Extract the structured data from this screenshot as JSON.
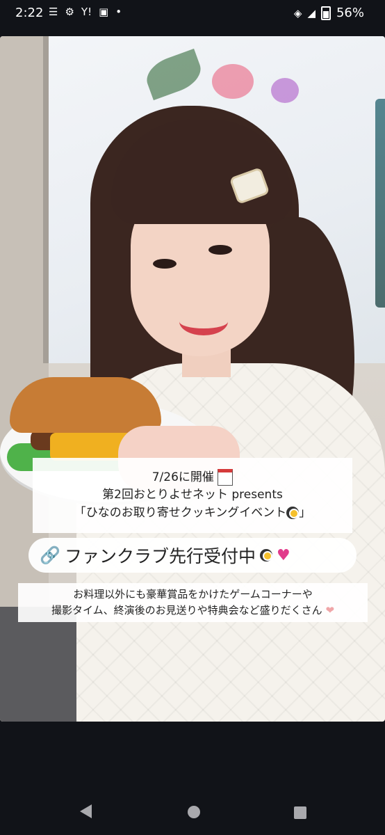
{
  "status_bar": {
    "time": "2:22",
    "notification_icons": [
      "chat-icon",
      "gear-icon",
      "yahoo-icon",
      "image-icon",
      "dot-icon"
    ],
    "yahoo_text": "Y!",
    "battery_text": "56%"
  },
  "overlay": {
    "line1": "7/26に開催",
    "line2": "第2回おとりよせネット presents",
    "line3": "「ひなのお取り寄せクッキングイベント",
    "line3_end": "」",
    "fanclub_text": "ファンクラブ先行受付中",
    "desc_line1": "お料理以外にも豪華賞品をかけたゲームコーナーや",
    "desc_line2": "撮影タイム、終演後のお見送りや特典会など盛りだくさん"
  },
  "colors": {
    "background": "#111318",
    "link_blue": "#3c7be3",
    "heart_pink": "#e13b8b"
  }
}
